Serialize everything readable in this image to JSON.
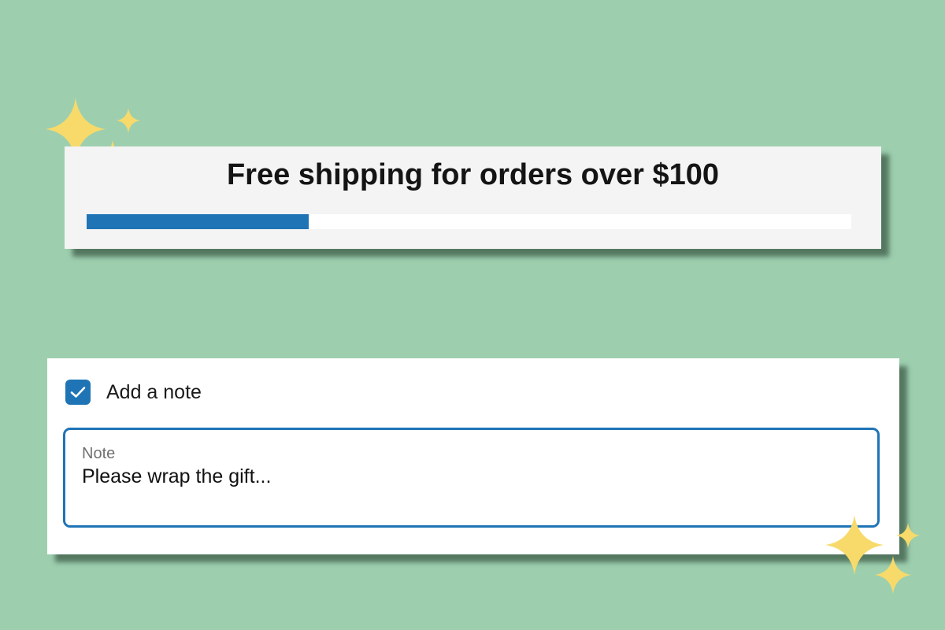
{
  "shipping_banner": {
    "title": "Free shipping for orders over $100",
    "progress_fraction": 0.29
  },
  "note_section": {
    "checkbox_label": "Add a note",
    "checkbox_checked": true,
    "field_label": "Note",
    "field_value": "Please wrap the gift..."
  },
  "colors": {
    "background": "#9dcfaf",
    "accent": "#1f74b6",
    "sparkle": "#f7da6a"
  },
  "icons": {
    "checkmark": "check-icon",
    "decoration": "sparkle-icon"
  }
}
